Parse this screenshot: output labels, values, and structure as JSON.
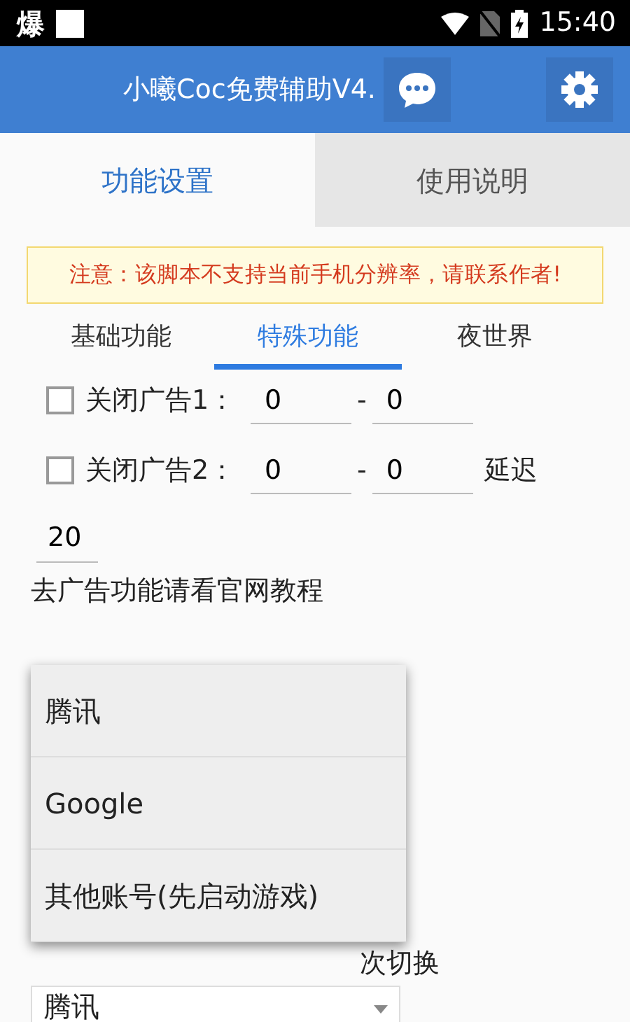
{
  "status_bar": {
    "app_glyph": "爆",
    "time": "15:40"
  },
  "app_bar": {
    "title": "小曦Coc免费辅助V4."
  },
  "tabs": [
    {
      "label": "功能设置",
      "selected": true
    },
    {
      "label": "使用说明",
      "selected": false
    }
  ],
  "notice": "注意：该脚本不支持当前手机分辨率，请联系作者!",
  "subtabs": [
    {
      "label": "基础功能",
      "selected": false
    },
    {
      "label": "特殊功能",
      "selected": true
    },
    {
      "label": "夜世界",
      "selected": false
    }
  ],
  "ad_rows": [
    {
      "label": "关闭广告1：",
      "checked": false,
      "from": "0",
      "separator": "-",
      "to": "0"
    },
    {
      "label": "关闭广告2：",
      "checked": false,
      "from": "0",
      "separator": "-",
      "to": "0",
      "suffix": "延迟"
    }
  ],
  "delay_value": "20",
  "hint": "去广告功能请看官网教程",
  "switch_row": {
    "suffix": "次切换"
  },
  "account_select": {
    "value": "腾讯"
  },
  "dropdown": [
    {
      "label": "腾讯"
    },
    {
      "label": "Google"
    },
    {
      "label": "其他账号(先启动游戏)"
    }
  ]
}
